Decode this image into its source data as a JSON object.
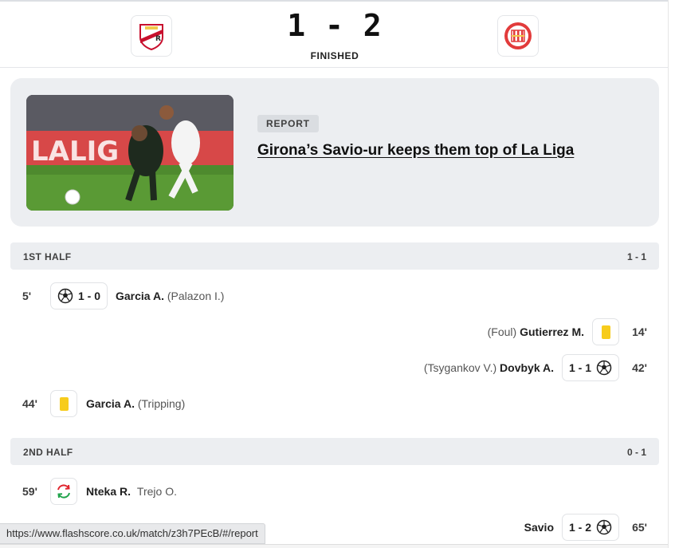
{
  "match": {
    "score": "1 - 2",
    "status": "FINISHED",
    "home_logo": "rayo-vallecano-crest",
    "away_logo": "girona-crest"
  },
  "report": {
    "tag": "REPORT",
    "title": "Girona’s Savio-ur keeps them top of La Liga",
    "image": "football-action-photo"
  },
  "halves": [
    {
      "label": "1ST HALF",
      "score": "1 - 1",
      "events": [
        {
          "side": "home",
          "minute": "5'",
          "icon": "goal-ball-icon",
          "score": "1 - 0",
          "player": "Garcia A.",
          "detail": "(Palazon I.)"
        },
        {
          "side": "away",
          "minute": "14'",
          "icon": "yellow-card-icon",
          "player": "Gutierrez M.",
          "detail": "(Foul)"
        },
        {
          "side": "away",
          "minute": "42'",
          "icon": "goal-ball-icon",
          "score": "1 - 1",
          "player": "Dovbyk A.",
          "detail": "(Tsygankov V.)"
        },
        {
          "side": "home",
          "minute": "44'",
          "icon": "yellow-card-icon",
          "player": "Garcia A.",
          "detail": "(Tripping)"
        }
      ]
    },
    {
      "label": "2ND HALF",
      "score": "0 - 1",
      "events": [
        {
          "side": "home",
          "minute": "59'",
          "icon": "substitution-icon",
          "player": "Nteka R.",
          "detail": "Trejo O."
        },
        {
          "side": "away",
          "minute": "65'",
          "icon": "goal-ball-icon",
          "score": "1 - 2",
          "player": "Savio",
          "detail": ""
        }
      ]
    }
  ],
  "statusbar": {
    "url": "https://www.flashscore.co.uk/match/z3h7PEcB/#/report"
  },
  "colors": {
    "card_yellow": "#f7cc1c",
    "panel_grey": "#eceef1",
    "sub_green": "#1fa34a",
    "sub_red": "#e0242d"
  }
}
